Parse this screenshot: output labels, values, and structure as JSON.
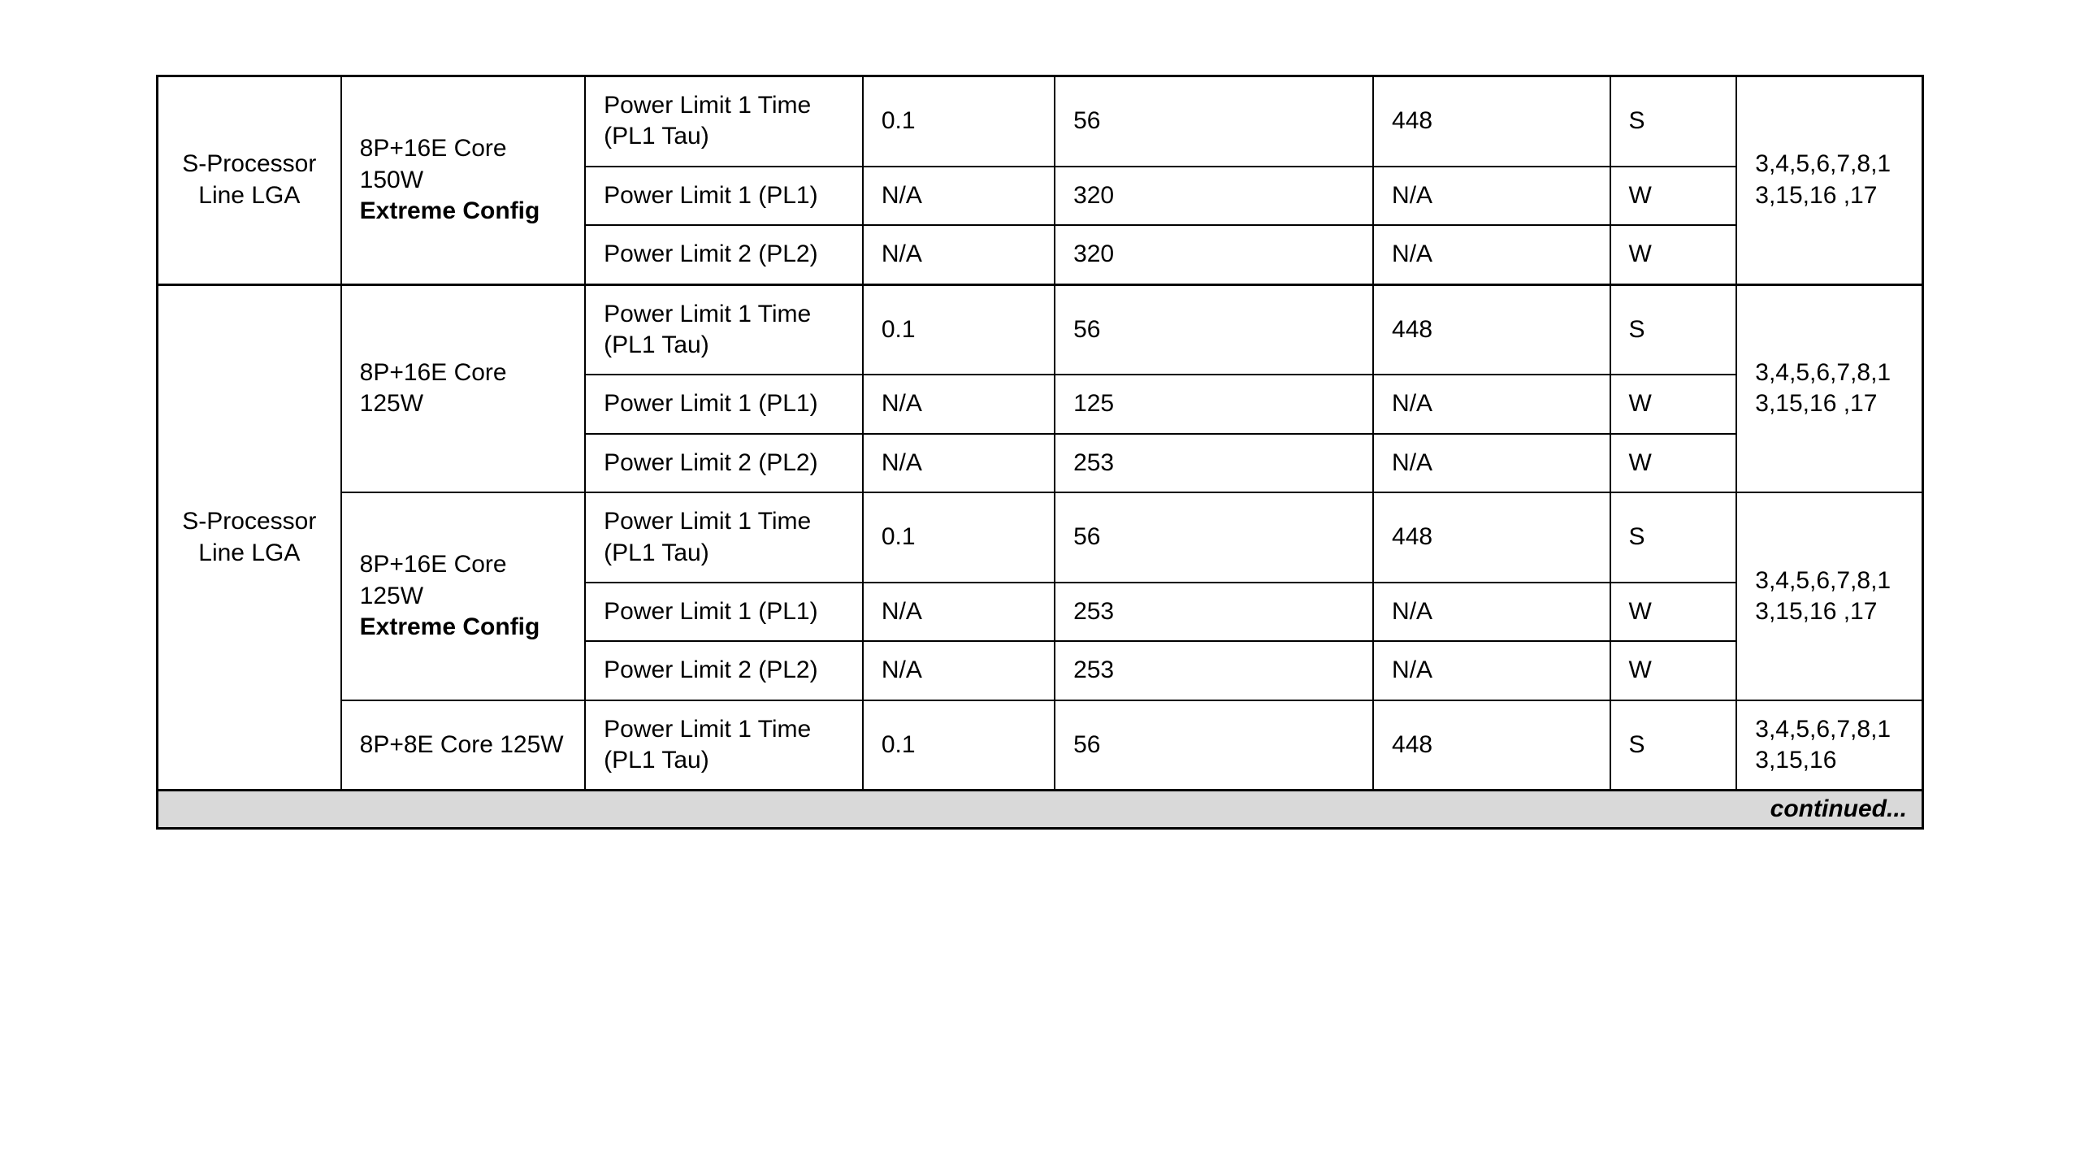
{
  "footer": "continued...",
  "notes": "3,4,5,6,7,8,13,15,16 ,17",
  "notes_last": "3,4,5,6,7,8,13,15,16",
  "proc": {
    "g1": "S-Processor Line LGA",
    "g2": "S-Processor Line LGA"
  },
  "seg": {
    "a": "8P+16E Core 150W",
    "a_bold": "Extreme Config",
    "b": "8P+16E Core 125W",
    "c": "8P+16E Core 125W",
    "c_bold": "Extreme Config",
    "d": "8P+8E Core 125W"
  },
  "param": {
    "pl1tau": "Power Limit 1 Time (PL1 Tau)",
    "pl1": "Power Limit 1 (PL1)",
    "pl2": "Power Limit 2 (PL2)"
  },
  "rows": {
    "r1": {
      "min": "0.1",
      "rec": "56",
      "max": "448",
      "u": "S"
    },
    "r2": {
      "min": "N/A",
      "rec": "320",
      "max": "N/A",
      "u": "W"
    },
    "r3": {
      "min": "N/A",
      "rec": "320",
      "max": "N/A",
      "u": "W"
    },
    "r4": {
      "min": "0.1",
      "rec": "56",
      "max": "448",
      "u": "S"
    },
    "r5": {
      "min": "N/A",
      "rec": "125",
      "max": "N/A",
      "u": "W"
    },
    "r6": {
      "min": "N/A",
      "rec": "253",
      "max": "N/A",
      "u": "W"
    },
    "r7": {
      "min": "0.1",
      "rec": "56",
      "max": "448",
      "u": "S"
    },
    "r8": {
      "min": "N/A",
      "rec": "253",
      "max": "N/A",
      "u": "W"
    },
    "r9": {
      "min": "N/A",
      "rec": "253",
      "max": "N/A",
      "u": "W"
    },
    "r10": {
      "min": "0.1",
      "rec": "56",
      "max": "448",
      "u": "S"
    }
  }
}
